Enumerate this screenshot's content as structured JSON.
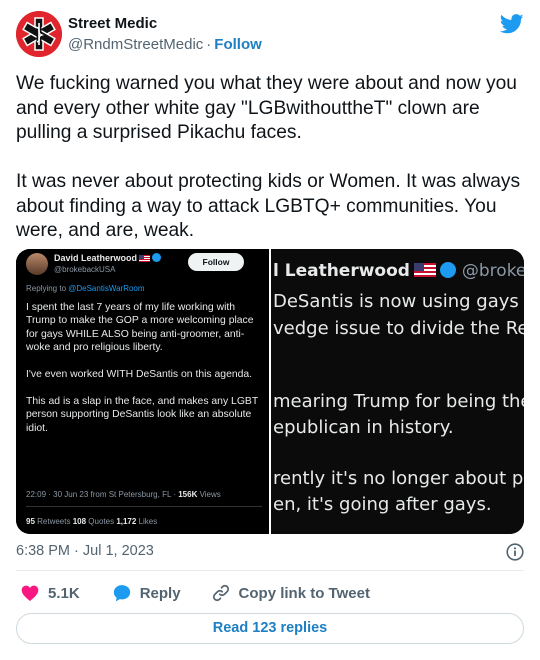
{
  "author": {
    "name": "Street Medic",
    "handle": "@RndmStreetMedic",
    "separator": "·",
    "follow_label": "Follow"
  },
  "tweet": {
    "text": "We fucking warned you what they were about and now you and every other white gay \"LGBwithouttheT\" clown are pulling a surprised Pikachu faces.\n\nIt was never about protecting kids or Women. It was always about finding a way to attack LGBTQ+ communities. You were, and are, weak."
  },
  "media": {
    "left": {
      "name": "David Leatherwood",
      "handle": "@brokebackUSA",
      "follow_label": "Follow",
      "replying_prefix": "Replying to ",
      "replying_to": "@DeSantisWarRoom",
      "body": "I spent the last 7 years of my life working with Trump to make the GOP a more welcoming place for gays WHILE ALSO being anti-groomer, anti-woke and pro religious liberty.\n\nI've even worked WITH DeSantis on this agenda.\n\nThis ad is a slap in the face, and makes any LGBT person supporting DeSantis look like an absolute idiot.",
      "meta": "22:09 · 30 Jun 23 from St Petersburg, FL · ",
      "views_count": "156K",
      "views_label": " Views",
      "retweets_count": "95",
      "retweets_label": " Retweets  ",
      "quotes_count": "108",
      "quotes_label": " Quotes  ",
      "likes_count": "1,172",
      "likes_label": " Likes"
    },
    "right": {
      "line1_name": "l Leatherwood",
      "line1_handle": "@broke",
      "line2": "DeSantis is now using gays a",
      "line3": "vedge issue to divide the Rep",
      "line4": "mearing Trump for being the",
      "line5": "epublican in history.",
      "line6": "rently it's no longer about pro",
      "line7": "en, it's going after gays."
    }
  },
  "timestamp": "6:38 PM · Jul 1, 2023",
  "actions": {
    "likes": "5.1K",
    "reply": "Reply",
    "copy": "Copy link to Tweet"
  },
  "read_replies": "Read 123 replies",
  "colors": {
    "accent": "#1d9bf0",
    "like": "#f91880",
    "avatar_bg": "#e0262c"
  }
}
